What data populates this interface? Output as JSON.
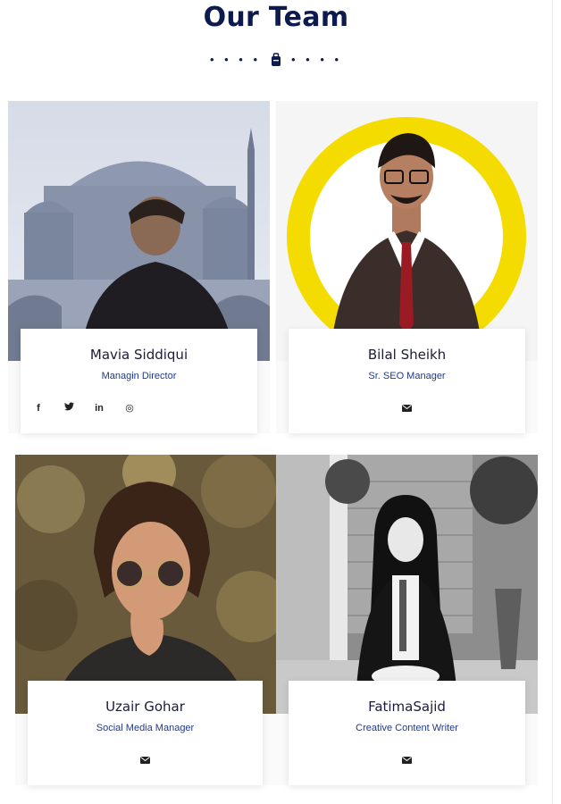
{
  "section_title": "Our Team",
  "colors": {
    "title": "#0c1a4e",
    "role": "#1f3a8a",
    "accent_ring": "#f4dc00"
  },
  "members": [
    {
      "name": "Mavia Siddiqui",
      "role": "Managin Director",
      "socials": [
        "facebook-icon",
        "twitter-icon",
        "linkedin-icon",
        "instagram-icon"
      ]
    },
    {
      "name": "Bilal Sheikh",
      "role": "Sr. SEO Manager",
      "socials": [
        "email-icon"
      ]
    },
    {
      "name": "Uzair Gohar",
      "role": "Social Media Manager",
      "socials": [
        "email-icon"
      ]
    },
    {
      "name": "FatimaSajid",
      "role": "Creative Content Writer",
      "socials": [
        "email-icon"
      ]
    }
  ],
  "social_glyphs": {
    "facebook": "f",
    "twitter": "t",
    "linkedin": "in",
    "instagram": "◎"
  }
}
